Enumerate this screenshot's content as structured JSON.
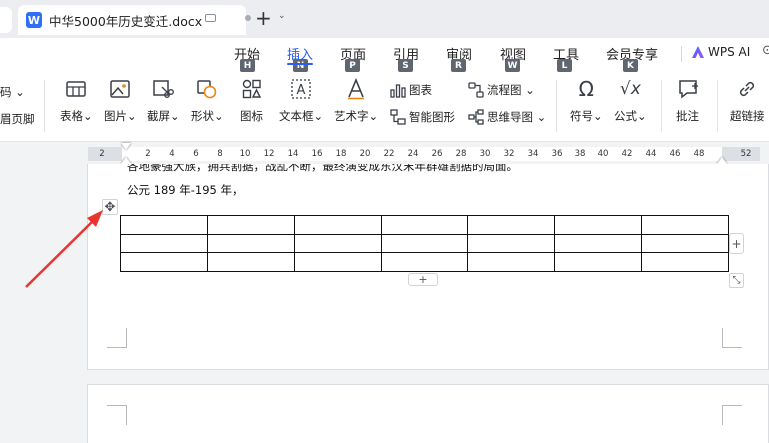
{
  "titlebar": {
    "doc_name": "中华5000年历史变迁.docx",
    "app_badge": "W",
    "new_tab": "+",
    "new_tab_arrow": "⌄"
  },
  "menu": {
    "items": [
      {
        "label": "开始",
        "key": "H"
      },
      {
        "label": "插入",
        "key": "N"
      },
      {
        "label": "页面",
        "key": "P"
      },
      {
        "label": "引用",
        "key": "S"
      },
      {
        "label": "审阅",
        "key": "R"
      },
      {
        "label": "视图",
        "key": "W"
      },
      {
        "label": "工具",
        "key": "L"
      },
      {
        "label": "会员专享",
        "key": "K"
      }
    ],
    "active": "插入",
    "wps_ai": "WPS AI"
  },
  "ribbon": {
    "left_partial_top": "码 ⌄",
    "left_partial_bottom": "眉页脚",
    "table": "表格⌄",
    "picture": "图片⌄",
    "screenshot": "截屏⌄",
    "shape": "形状⌄",
    "icon": "图标",
    "textbox": "文本框⌄",
    "wordart": "艺术字⌄",
    "chart": "图表",
    "smartart": "智能图形",
    "flowchart": "流程图 ⌄",
    "mindmap": "思维导图 ⌄",
    "symbol": "符号⌄",
    "formula": "公式⌄",
    "comment": "批注",
    "hyperlink": "超链接"
  },
  "ruler": {
    "numbers": [
      "2",
      "2",
      "4",
      "6",
      "8",
      "10",
      "12",
      "14",
      "16",
      "18",
      "20",
      "22",
      "24",
      "26",
      "28",
      "30",
      "32",
      "34",
      "36",
      "38",
      "40",
      "42",
      "44",
      "46",
      "48",
      "52"
    ]
  },
  "document": {
    "cut_line": "各地豪强大族，拥兵割据，战乱不断，最终演变成东汉末年群雄割据的局面。",
    "line": "公元 189 年-195 年，",
    "table": {
      "rows": 3,
      "cols": 7
    }
  },
  "controls": {
    "move_handle": "✥",
    "add_column": "+",
    "add_row": "+",
    "resize": "⤡"
  },
  "colors": {
    "accent": "#2a5cff",
    "annotation_arrow": "#e8352e"
  }
}
